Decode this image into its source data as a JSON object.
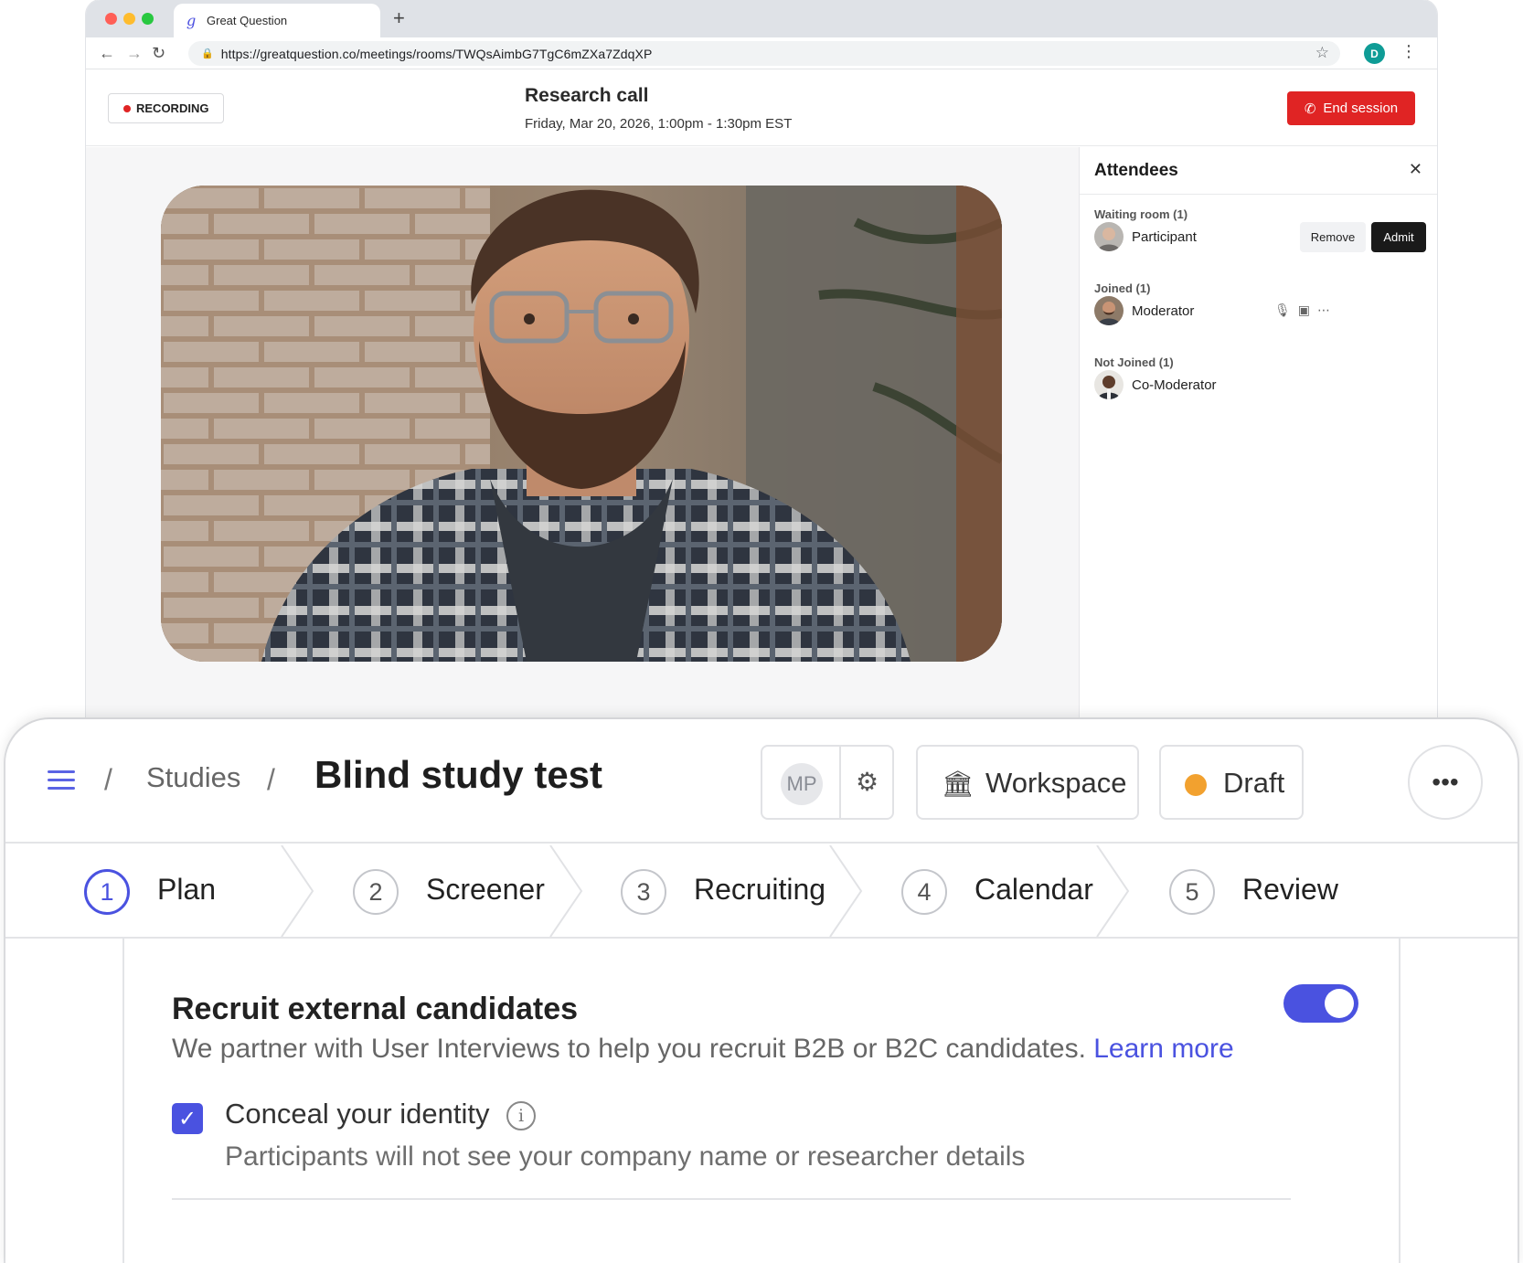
{
  "browser": {
    "tab_title": "Great Question",
    "tab_favicon": "g",
    "new_tab": "+",
    "url": "https://greatquestion.co/meetings/rooms/TWQsAimbG7TgC6mZXa7ZdqXP",
    "profile_initial": "D",
    "icons": [
      "back-arrow-icon",
      "forward-arrow-icon",
      "reload-icon",
      "lock-icon",
      "star-icon",
      "kebab-menu-icon"
    ]
  },
  "meeting": {
    "recording_label": "RECORDING",
    "title": "Research call",
    "time": "Friday, Mar 20, 2026, 1:00pm - 1:30pm EST",
    "end_session_label": "End session",
    "colors": {
      "danger": "#e02424",
      "recording_dot": "#e02424"
    }
  },
  "attendees": {
    "title": "Attendees",
    "waiting": {
      "label": "Waiting room (1)",
      "name": "Participant",
      "remove_label": "Remove",
      "admit_label": "Admit"
    },
    "joined": {
      "label": "Joined (1)",
      "name": "Moderator",
      "icons": [
        "microphone-icon",
        "camera-icon",
        "more-options-icon"
      ]
    },
    "not_joined": {
      "label": "Not Joined (1)",
      "name": "Co-Moderator"
    }
  },
  "study": {
    "breadcrumb_sep": "/",
    "breadcrumb_studies": "Studies",
    "title": "Blind study test",
    "avatar_initials": "MP",
    "workspace_label": "Workspace",
    "status_label": "Draft",
    "more_label": "•••",
    "colors": {
      "accent": "#4a52e0",
      "draft": "#f2a12f"
    },
    "steps": [
      {
        "num": "1",
        "label": "Plan",
        "active": true
      },
      {
        "num": "2",
        "label": "Screener",
        "active": false
      },
      {
        "num": "3",
        "label": "Recruiting",
        "active": false
      },
      {
        "num": "4",
        "label": "Calendar",
        "active": false
      },
      {
        "num": "5",
        "label": "Review",
        "active": false
      }
    ],
    "recruit": {
      "title": "Recruit external candidates",
      "description": "We partner with User Interviews to help you recruit B2B or B2C candidates.",
      "learn_more": "Learn more",
      "toggle_on": true,
      "conceal_label": "Conceal your identity",
      "conceal_checked": true,
      "conceal_help": "Participants will not see your company name or researcher details"
    }
  }
}
